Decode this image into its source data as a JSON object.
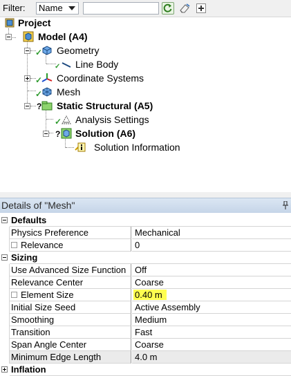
{
  "toolbar": {
    "filter_label": "Filter:",
    "filter_value": "Name",
    "search_value": ""
  },
  "tree": {
    "project": "Project",
    "model": "Model (A4)",
    "geometry": "Geometry",
    "line_body": "Line Body",
    "coordinate_systems": "Coordinate Systems",
    "mesh": "Mesh",
    "static_structural": "Static Structural (A5)",
    "analysis_settings": "Analysis Settings",
    "solution": "Solution (A6)",
    "solution_information": "Solution Information"
  },
  "details": {
    "title": "Details of \"Mesh\"",
    "rows": [
      {
        "type": "section",
        "label": "Defaults",
        "expanded": true
      },
      {
        "label": "Physics Preference",
        "value": "Mechanical"
      },
      {
        "label": "Relevance",
        "value": "0",
        "checkbox": true
      },
      {
        "type": "section",
        "label": "Sizing",
        "expanded": true
      },
      {
        "label": "Use Advanced Size Function",
        "value": "Off"
      },
      {
        "label": "Relevance Center",
        "value": "Coarse"
      },
      {
        "label": "Element Size",
        "value": "0.40 m",
        "checkbox": true,
        "highlight": true
      },
      {
        "label": "Initial Size Seed",
        "value": "Active Assembly"
      },
      {
        "label": "Smoothing",
        "value": "Medium"
      },
      {
        "label": "Transition",
        "value": "Fast"
      },
      {
        "label": "Span Angle Center",
        "value": "Coarse"
      },
      {
        "label": "Minimum Edge Length",
        "value": "4.0 m",
        "readonly": true
      },
      {
        "type": "section",
        "label": "Inflation",
        "expanded": false
      }
    ]
  },
  "colors": {
    "highlight": "#ffff50",
    "header_bg": "#c6d5e8",
    "check_green": "#2d9a2d"
  }
}
